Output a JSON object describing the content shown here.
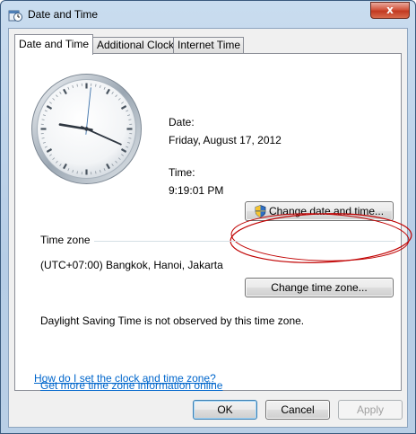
{
  "window": {
    "title": "Date and Time",
    "close_glyph": "x"
  },
  "tabs": [
    {
      "label": "Date and Time",
      "active": true
    },
    {
      "label": "Additional Clocks",
      "active": false
    },
    {
      "label": "Internet Time",
      "active": false
    }
  ],
  "datetime": {
    "date_label": "Date:",
    "date_value": "Friday, August 17, 2012",
    "time_label": "Time:",
    "time_value": "9:19:01 PM",
    "change_button": "Change date and time..."
  },
  "timezone": {
    "section_label": "Time zone",
    "value": "(UTC+07:00) Bangkok, Hanoi, Jakarta",
    "change_button": "Change time zone...",
    "dst_note": "Daylight Saving Time is not observed by this time zone."
  },
  "links": {
    "more_info": "Get more time zone information online",
    "how_to": "How do I set the clock and time zone?"
  },
  "footer": {
    "ok": "OK",
    "cancel": "Cancel",
    "apply": "Apply"
  },
  "clock": {
    "hour": 9,
    "minute": 19,
    "second": 1
  },
  "icons": {
    "title": "date-time-icon",
    "uac": "shield-icon"
  },
  "colors": {
    "link": "#0066cc",
    "annotation": "#c00000"
  }
}
